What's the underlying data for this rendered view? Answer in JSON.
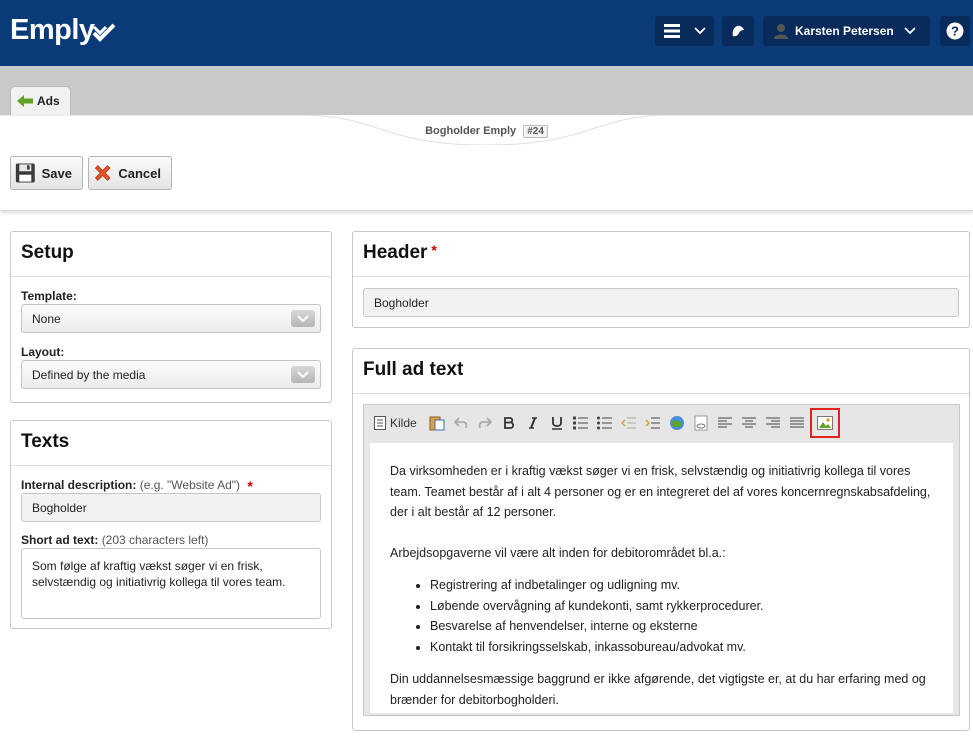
{
  "app": {
    "logo_text": "Emply"
  },
  "topbar": {
    "user_name": "Karsten Petersen",
    "help_label": "?"
  },
  "breadcrumb": {
    "back_label": "Ads"
  },
  "title": {
    "name": "Bogholder Emply",
    "id": "#24"
  },
  "toolbar": {
    "save_label": "Save",
    "cancel_label": "Cancel"
  },
  "setup": {
    "title": "Setup",
    "template_label": "Template:",
    "template_value": "None",
    "layout_label": "Layout:",
    "layout_value": "Defined by the media"
  },
  "texts": {
    "title": "Texts",
    "internal_label": "Internal description:",
    "internal_hint": "(e.g. \"Website Ad\")",
    "internal_value": "Bogholder",
    "short_label": "Short ad text:",
    "short_hint": "(203 characters left)",
    "short_value": "Som følge af kraftig vækst søger vi en frisk, selvstændig og initiativrig kollega til vores team."
  },
  "header": {
    "title": "Header",
    "value": "Bogholder"
  },
  "full_ad": {
    "title": "Full ad text",
    "source_label": "Kilde",
    "paragraph1": "Da virksomheden er i kraftig vækst søger vi en frisk, selvstændig og initiativrig kollega til vores team. Teamet består af i alt 4 personer og er en integreret del af vores koncernregnskabsafdeling, der i alt består af 12 personer.",
    "paragraph2": "Arbejdsopgaverne vil være alt inden for debitorområdet bl.a.:",
    "bullets": [
      "Registrering af indbetalinger og udligning mv.",
      "Løbende overvågning af kundekonti, samt rykkerprocedurer.",
      "Besvarelse af henvendelser, interne og eksterne",
      "Kontakt til forsikringsselskab, inkassobureau/advokat mv."
    ],
    "paragraph3": "Din uddannelsesmæssige baggrund er ikke afgørende, det vigtigste er, at du har erfaring med og brænder for debitorbogholderi."
  },
  "required_mark": "*"
}
